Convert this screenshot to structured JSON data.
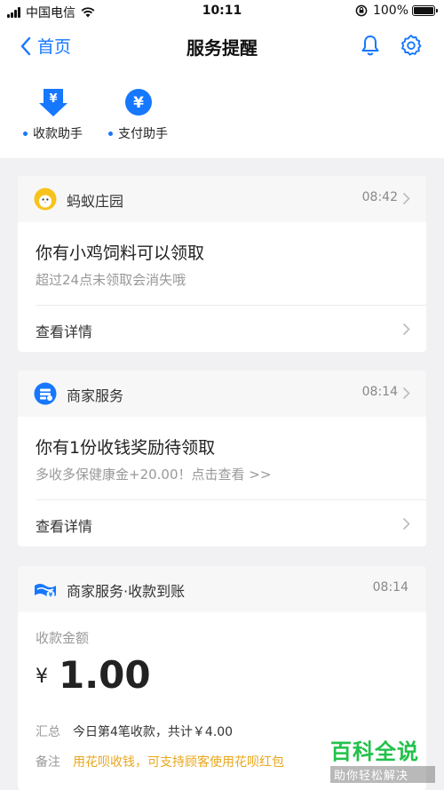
{
  "status_bar": {
    "carrier": "中国电信",
    "time": "10:11",
    "battery": "100%",
    "battery_level": 1.0
  },
  "nav": {
    "back_label": "首页",
    "title": "服务提醒"
  },
  "helpers": [
    {
      "label": "收款助手",
      "icon": "yuan-download-icon"
    },
    {
      "label": "支付助手",
      "icon": "yuan-circle-icon"
    }
  ],
  "cards": [
    {
      "icon": "chick-avatar-icon",
      "title": "蚂蚁庄园",
      "time": "08:42",
      "headline": "你有小鸡饲料可以领取",
      "subtitle": "超过24点未领取会消失哦",
      "link": "查看详情"
    },
    {
      "icon": "merchant-service-icon",
      "title": "商家服务",
      "time": "08:14",
      "headline": "你有1份收钱奖励待领取",
      "subtitle": "多收多保健康金+20.00！点击查看 >>",
      "link": "查看详情"
    },
    {
      "icon": "merchant-receipt-icon",
      "title": "商家服务·收款到账",
      "time": "08:14",
      "amount_label": "收款金额",
      "currency": "¥",
      "amount": "1.00",
      "summary_label": "汇总",
      "summary_value": "今日第4笔收款，共计￥4.00",
      "note_label": "备注",
      "note_value": "用花呗收钱，可支持顾客使用花呗红包"
    }
  ],
  "watermark": {
    "title": "百科全说",
    "subtitle": "助你轻松解决"
  },
  "colors": {
    "accent": "#1677ff",
    "note": "#e8a71b",
    "watermark": "#22c14a"
  }
}
